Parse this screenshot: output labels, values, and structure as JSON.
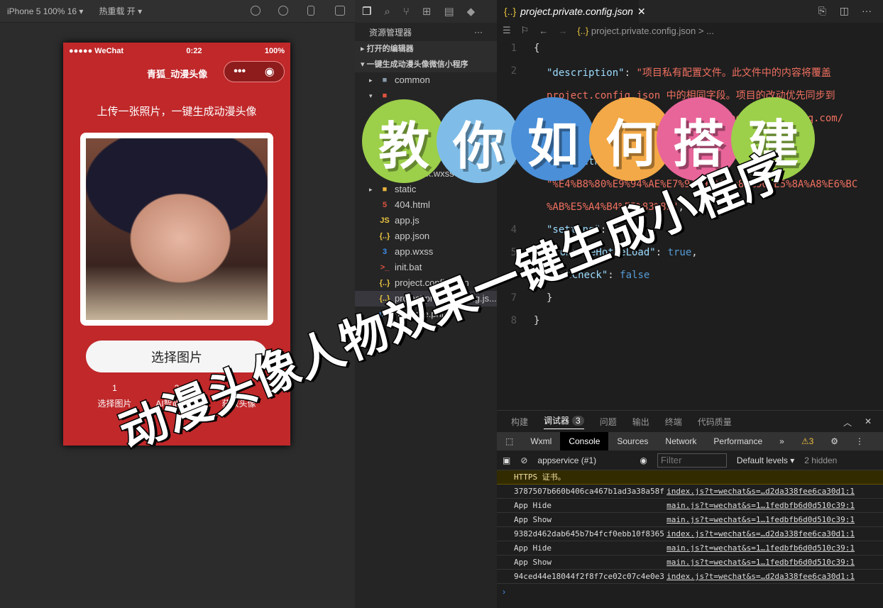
{
  "simulator": {
    "device": "iPhone 5 100% 16 ▾",
    "hotreload": "热重载 开 ▾"
  },
  "phone": {
    "signal": "●●●●● WeChat",
    "time": "0:22",
    "battery": "100%",
    "title": "青狐_动漫头像",
    "subtitle": "上传一张照片，一键生成动漫头像",
    "pick_button": "选择图片",
    "steps": [
      {
        "num": "1",
        "label": "选择图片"
      },
      {
        "num": "2",
        "label": "AI智能生成"
      },
      {
        "num": "3",
        "label": "获取头像"
      }
    ]
  },
  "explorer": {
    "title": "资源管理器",
    "more": "···",
    "open_editors": "打开的编辑器",
    "project": "一键生成动漫头像微信小程序",
    "files": [
      {
        "name": "common",
        "icon": "folder",
        "color": "#8a9aa8",
        "indent": 1,
        "arrow": "▸"
      },
      {
        "name": "",
        "icon": "folder",
        "color": "#e0533f",
        "indent": 1,
        "arrow": "▾"
      },
      {
        "name": "",
        "icon": "",
        "color": "#ccc",
        "indent": 2,
        "arrow": ""
      },
      {
        "name": "",
        "icon": "",
        "color": "#ccc",
        "indent": 2,
        "arrow": ""
      },
      {
        "name": "",
        "icon": "",
        "color": "#ccc",
        "indent": 2,
        "arrow": ""
      },
      {
        "name": "",
        "icon": "",
        "color": "#ccc",
        "indent": 2,
        "arrow": ""
      },
      {
        "name": "index.wxss",
        "icon": "",
        "color": "#ccc",
        "indent": 2,
        "arrow": ""
      },
      {
        "name": "static",
        "icon": "folder",
        "color": "#e8b33e",
        "indent": 1,
        "arrow": "▸"
      },
      {
        "name": "404.html",
        "icon": "5",
        "color": "#e0533f",
        "indent": 1,
        "arrow": ""
      },
      {
        "name": "app.js",
        "icon": "JS",
        "color": "#e8c33e",
        "indent": 1,
        "arrow": ""
      },
      {
        "name": "app.json",
        "icon": "{..}",
        "color": "#e8c33e",
        "indent": 1,
        "arrow": ""
      },
      {
        "name": "app.wxss",
        "icon": "3",
        "color": "#3e8fe8",
        "indent": 1,
        "arrow": ""
      },
      {
        "name": "init.bat",
        "icon": ">_",
        "color": "#e0533f",
        "indent": 1,
        "arrow": ""
      },
      {
        "name": "project.config.json",
        "icon": "{..}",
        "color": "#e8c33e",
        "indent": 1,
        "arrow": ""
      },
      {
        "name": "project.private.config.js...",
        "icon": "{..}",
        "color": "#e8c33e",
        "indent": 1,
        "arrow": "",
        "selected": true
      },
      {
        "name": "re adme.php",
        "icon": "php",
        "color": "#4a8fd8",
        "indent": 1,
        "arrow": ""
      }
    ]
  },
  "editor": {
    "tab": "project.private.config.json",
    "breadcrumb": "project.private.config.json > ...",
    "lines": [
      {
        "n": "1",
        "html": [
          [
            "p",
            "{"
          ]
        ]
      },
      {
        "n": "2",
        "html": [
          [
            "k",
            "\"description\""
          ],
          [
            "p",
            ": "
          ],
          [
            "s",
            "\"项目私有配置文件。此文件中的内容将覆盖"
          ]
        ]
      },
      {
        "n": "",
        "html": [
          [
            "s",
            "project.config.json 中的相同字段。项目的改动优先同步到"
          ]
        ]
      },
      {
        "n": "",
        "html": [
          [
            "s",
            "此文件中。详见文档：https://developers.weixin.qq.com/"
          ]
        ]
      },
      {
        "n": "",
        "html": [
          [
            "s",
            "miniprogram/dev/devtools/projectconfig.html\""
          ],
          [
            "p",
            ","
          ]
        ]
      },
      {
        "n": "3",
        "html": [
          [
            "k",
            "\"projectname\""
          ],
          [
            "p",
            ":"
          ]
        ]
      },
      {
        "n": "",
        "html": [
          [
            "s",
            "\"%E4%B8%80%E9%94%AE%E7%94%9F%E6%88%90%E5%8A%A8%E6%BC"
          ]
        ]
      },
      {
        "n": "",
        "html": [
          [
            "s",
            "%AB%E5%A4%B4%E5%83%8F\""
          ],
          [
            "p",
            ","
          ]
        ]
      },
      {
        "n": "4",
        "html": [
          [
            "k",
            "\"setting\""
          ],
          [
            "p",
            ": {"
          ]
        ]
      },
      {
        "n": "5",
        "html": [
          [
            "k",
            "  \"compileHotReLoad\""
          ],
          [
            "p",
            ": "
          ],
          [
            "b",
            "true"
          ],
          [
            "p",
            ","
          ]
        ]
      },
      {
        "n": "6",
        "html": [
          [
            "k",
            "  \"urlCheck\""
          ],
          [
            "p",
            ": "
          ],
          [
            "b",
            "false"
          ]
        ]
      },
      {
        "n": "7",
        "html": [
          [
            "p",
            "}"
          ]
        ]
      },
      {
        "n": "8",
        "html": [
          [
            "p",
            "}"
          ]
        ]
      }
    ]
  },
  "panel": {
    "tabs": [
      "构建",
      "调试器",
      "问题",
      "输出",
      "终端",
      "代码质量"
    ],
    "debugger_badge": "3",
    "devtabs": [
      "Wxml",
      "Console",
      "Sources",
      "Network",
      "Performance",
      "»"
    ],
    "warnings": "⚠3",
    "context": "appservice (#1)",
    "filter_placeholder": "Filter",
    "levels": "Default levels ▾",
    "hidden": "2 hidden",
    "rows": [
      {
        "msg": "HTTPS 证书。",
        "src": "",
        "warn": true
      },
      {
        "msg": "3787507b660b406ca467b1ad3a38a58f",
        "src": "index.js?t=wechat&s=…d2da338fee6ca30d1:1"
      },
      {
        "msg": "App Hide",
        "src": "main.js?t=wechat&s=1…1fedbfb6d0d510c39:1"
      },
      {
        "msg": "App Show",
        "src": "main.js?t=wechat&s=1…1fedbfb6d0d510c39:1"
      },
      {
        "msg": "9382d462dab645b7b4fcf0ebb10f8365",
        "src": "index.js?t=wechat&s=…d2da338fee6ca30d1:1"
      },
      {
        "msg": "App Hide",
        "src": "main.js?t=wechat&s=1…1fedbfb6d0d510c39:1"
      },
      {
        "msg": "App Show",
        "src": "main.js?t=wechat&s=1…1fedbfb6d0d510c39:1"
      },
      {
        "msg": "94ced44e18044f2f8f7ce02c07c4e0e3",
        "src": "index.js?t=wechat&s=…d2da338fee6ca30d1:1"
      }
    ],
    "prompt": "›"
  },
  "overlay": {
    "circles": [
      {
        "char": "教",
        "color": "#9ccf4a"
      },
      {
        "char": "你",
        "color": "#7fbde8"
      },
      {
        "char": "如",
        "color": "#4a8fd8"
      },
      {
        "char": "何",
        "color": "#f3a947"
      },
      {
        "char": "搭",
        "color": "#e8659a"
      },
      {
        "char": "建",
        "color": "#9ccf4a"
      }
    ],
    "slogan": "动漫头像人物效果一键生成小程序"
  }
}
